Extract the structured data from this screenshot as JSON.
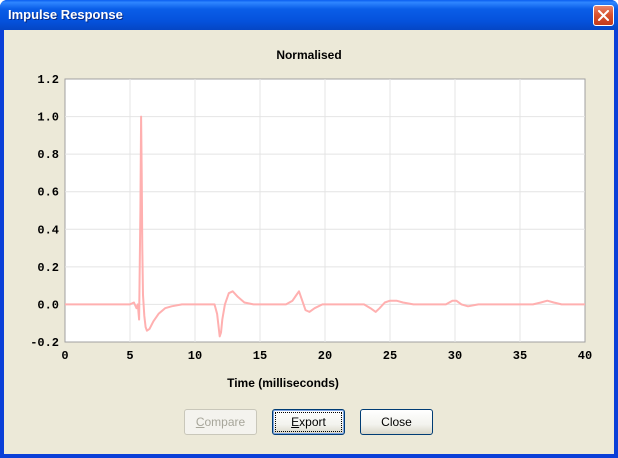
{
  "window": {
    "title": "Impulse Response"
  },
  "buttons": {
    "compare": {
      "label": "Compare",
      "mnemonic": "C",
      "rest": "ompare",
      "enabled": false
    },
    "export": {
      "label": "Export",
      "mnemonic": "E",
      "rest": "xport",
      "enabled": true
    },
    "close": {
      "label": "Close",
      "enabled": true
    }
  },
  "chart_data": {
    "type": "line",
    "title": "Normalised",
    "xlabel": "Time (milliseconds)",
    "ylabel": "",
    "xlim": [
      0,
      40
    ],
    "ylim": [
      -0.2,
      1.2
    ],
    "xticks": [
      "0",
      "5",
      "10",
      "15",
      "20",
      "25",
      "30",
      "35",
      "40"
    ],
    "yticks": [
      "1.2",
      "1.0",
      "0.8",
      "0.6",
      "0.4",
      "0.2",
      "0.0",
      "-0.2"
    ],
    "grid": true,
    "series": [
      {
        "color": "#ffb0b0",
        "x": [
          0,
          5.0,
          5.3,
          5.5,
          5.6,
          5.7,
          5.8,
          5.85,
          5.9,
          5.95,
          6.0,
          6.1,
          6.2,
          6.3,
          6.5,
          6.8,
          7.2,
          7.7,
          8.2,
          9.0,
          10.0,
          11.0,
          11.5,
          11.7,
          11.9,
          12.0,
          12.1,
          12.3,
          12.6,
          12.9,
          13.3,
          13.8,
          14.5,
          15.5,
          17.0,
          17.5,
          17.8,
          18.0,
          18.2,
          18.5,
          18.8,
          19.2,
          19.8,
          20.5,
          22.0,
          23.0,
          23.5,
          23.9,
          24.2,
          24.6,
          25.0,
          25.5,
          26.0,
          26.8,
          28.0,
          29.3,
          29.8,
          30.1,
          30.5,
          31.0,
          31.8,
          33.0,
          36.0,
          36.6,
          37.1,
          37.6,
          38.2,
          40.0
        ],
        "y": [
          0.0,
          0.0,
          0.01,
          -0.02,
          0.0,
          -0.08,
          0.5,
          1.0,
          0.7,
          0.3,
          0.05,
          -0.06,
          -0.12,
          -0.14,
          -0.13,
          -0.09,
          -0.05,
          -0.02,
          -0.01,
          0.0,
          0.0,
          0.0,
          0.0,
          -0.05,
          -0.17,
          -0.15,
          -0.08,
          0.0,
          0.06,
          0.07,
          0.04,
          0.01,
          0.0,
          0.0,
          0.0,
          0.02,
          0.05,
          0.07,
          0.03,
          -0.03,
          -0.04,
          -0.02,
          0.0,
          0.0,
          0.0,
          0.0,
          -0.02,
          -0.04,
          -0.02,
          0.01,
          0.02,
          0.02,
          0.01,
          0.0,
          0.0,
          0.0,
          0.02,
          0.02,
          0.0,
          -0.01,
          0.0,
          0.0,
          0.0,
          0.01,
          0.02,
          0.01,
          0.0,
          0.0
        ]
      }
    ]
  }
}
